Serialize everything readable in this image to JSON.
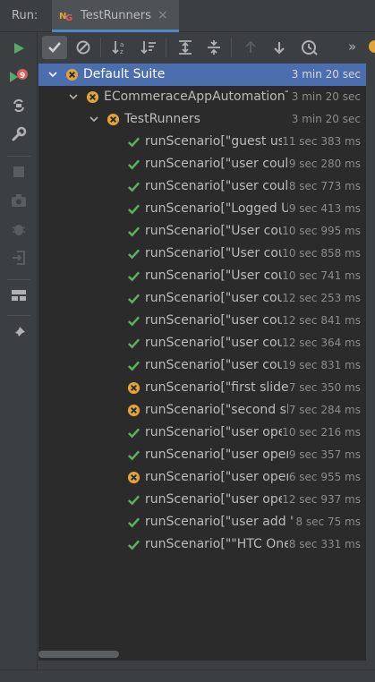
{
  "header": {
    "run_label": "Run:",
    "tab_title": "TestRunners",
    "tab_close": "×",
    "overflow": "»"
  },
  "left_toolbar": {
    "failed_count": "9"
  },
  "tree": {
    "rows": [
      {
        "label": "Default Suite",
        "duration": "3 min 20 sec",
        "status": "ignored",
        "level": 0,
        "expanded": true,
        "selected": true
      },
      {
        "label": "ECommeraceAppAutomationTe",
        "duration": "3 min 20 sec",
        "status": "ignored",
        "level": 1,
        "expanded": true,
        "selected": false
      },
      {
        "label": "TestRunners",
        "duration": "3 min 20 sec",
        "status": "ignored",
        "level": 2,
        "expanded": true,
        "selected": false
      },
      {
        "label": "runScenario[\"guest user",
        "duration": "11 sec 383 ms",
        "status": "passed",
        "level": 3
      },
      {
        "label": "runScenario[\"user could l",
        "duration": "9 sec 280 ms",
        "status": "passed",
        "level": 3
      },
      {
        "label": "runScenario[\"user could l",
        "duration": "8 sec 773 ms",
        "status": "passed",
        "level": 3
      },
      {
        "label": "runScenario[\"Logged Use",
        "duration": "9 sec 413 ms",
        "status": "passed",
        "level": 3
      },
      {
        "label": "runScenario[\"User coulc",
        "duration": "10 sec 995 ms",
        "status": "passed",
        "level": 3
      },
      {
        "label": "runScenario[\"User coulc",
        "duration": "10 sec 858 ms",
        "status": "passed",
        "level": 3
      },
      {
        "label": "runScenario[\"User coulc",
        "duration": "10 sec 741 ms",
        "status": "passed",
        "level": 3
      },
      {
        "label": "runScenario[\"user could",
        "duration": "12 sec 253 ms",
        "status": "passed",
        "level": 3
      },
      {
        "label": "runScenario[\"user could",
        "duration": "12 sec 841 ms",
        "status": "passed",
        "level": 3
      },
      {
        "label": "runScenario[\"user could",
        "duration": "12 sec 364 ms",
        "status": "passed",
        "level": 3
      },
      {
        "label": "runScenario[\"user could",
        "duration": "19 sec 831 ms",
        "status": "passed",
        "level": 3
      },
      {
        "label": "runScenario[\"first slider i",
        "duration": "7 sec 350 ms",
        "status": "ignored",
        "level": 3
      },
      {
        "label": "runScenario[\"second slid",
        "duration": "7 sec 284 ms",
        "status": "ignored",
        "level": 3
      },
      {
        "label": "runScenario[\"user opens",
        "duration": "10 sec 216 ms",
        "status": "passed",
        "level": 3
      },
      {
        "label": "runScenario[\"user opens",
        "duration": "9 sec 357 ms",
        "status": "passed",
        "level": 3
      },
      {
        "label": "runScenario[\"user opens",
        "duration": "6 sec 955 ms",
        "status": "ignored",
        "level": 3
      },
      {
        "label": "runScenario[\"user opens",
        "duration": "12 sec 937 ms",
        "status": "passed",
        "level": 3
      },
      {
        "label": "runScenario[\"user add \"H",
        "duration": "8 sec 75 ms",
        "status": "passed",
        "level": 3
      },
      {
        "label": "runScenario[\"\"HTC One M",
        "duration": "8 sec 331 ms",
        "status": "passed",
        "level": 3
      }
    ]
  },
  "colors": {
    "passed": "#5fb05d",
    "ignored": "#e0a43b",
    "selection": "#4b6eaf",
    "run_green": "#59a869",
    "failed_red": "#db5c5c"
  }
}
